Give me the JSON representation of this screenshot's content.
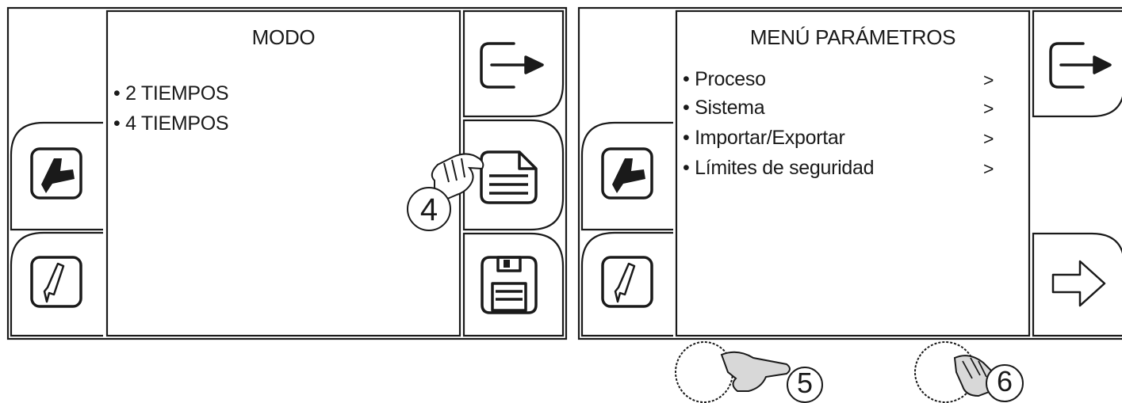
{
  "screen1": {
    "title": "MODO",
    "items": [
      "• 2 TIEMPOS",
      "• 4 TIEMPOS"
    ]
  },
  "screen2": {
    "title": "MENÚ PARÁMETROS",
    "items": [
      {
        "label": "• Proceso",
        "arrow": ">"
      },
      {
        "label": "• Sistema",
        "arrow": ">"
      },
      {
        "label": "• Importar/Exportar",
        "arrow": ">"
      },
      {
        "label": "• Límites de seguridad",
        "arrow": ">"
      }
    ]
  },
  "callouts": [
    "4",
    "5",
    "6"
  ],
  "icons": {
    "exit": "exit-arrow-icon",
    "menu": "document-menu-icon",
    "save": "floppy-disk-icon",
    "torch": "welding-torch-icon",
    "gun": "trigger-gun-icon",
    "next": "next-arrow-icon",
    "knob": "rotary-knob-icon",
    "hand": "pointing-hand-icon"
  }
}
